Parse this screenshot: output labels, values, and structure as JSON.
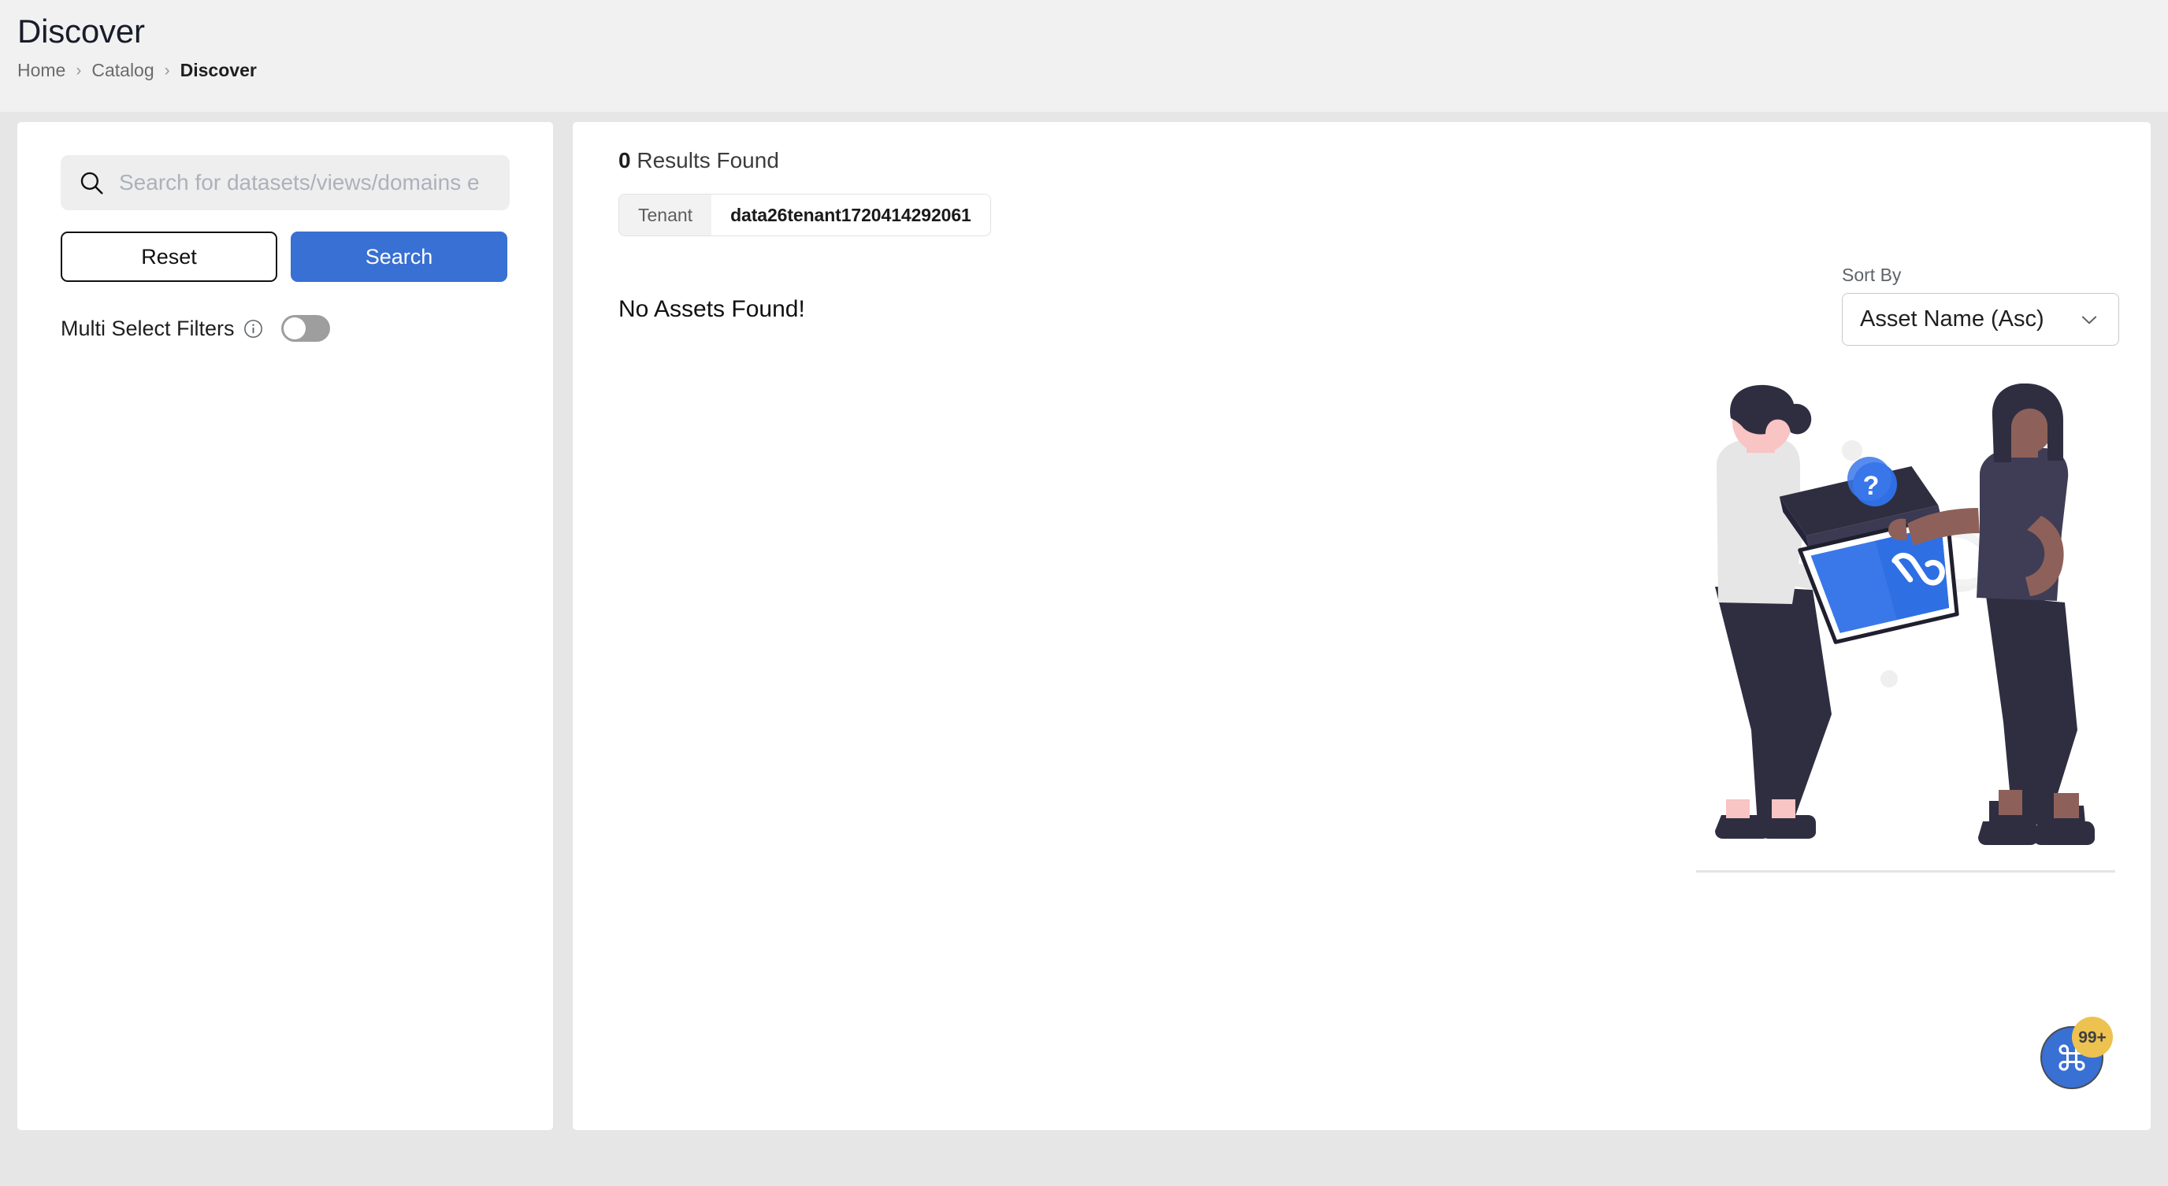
{
  "header": {
    "title": "Discover",
    "breadcrumb": [
      {
        "label": "Home",
        "current": false
      },
      {
        "label": "Catalog",
        "current": false
      },
      {
        "label": "Discover",
        "current": true
      }
    ],
    "separator": "›"
  },
  "filters": {
    "search": {
      "placeholder": "Search for datasets/views/domains e",
      "value": "",
      "icon": "search-icon"
    },
    "reset_label": "Reset",
    "search_label": "Search",
    "multi_select": {
      "label": "Multi Select Filters",
      "info_icon": "info-circle-icon",
      "enabled": false
    }
  },
  "results": {
    "count": "0",
    "count_suffix": " Results Found",
    "empty_message": "No Assets Found!",
    "applied_filters": [
      {
        "key": "Tenant",
        "value": "data26tenant1720414292061"
      }
    ]
  },
  "sort": {
    "label": "Sort By",
    "selected": "Asset Name (Asc)",
    "chevron_icon": "chevron-down-icon"
  },
  "illustration": {
    "name": "two-people-handing-box-illustration",
    "alt": "No assets found illustration"
  },
  "fab": {
    "icon": "command-key-icon",
    "badge": "99+"
  },
  "colors": {
    "accent": "#3870d3",
    "page_bg": "#e6e6e6",
    "header_bg": "#f1f1f1",
    "panel_bg": "#ffffff",
    "badge": "#edc250"
  }
}
